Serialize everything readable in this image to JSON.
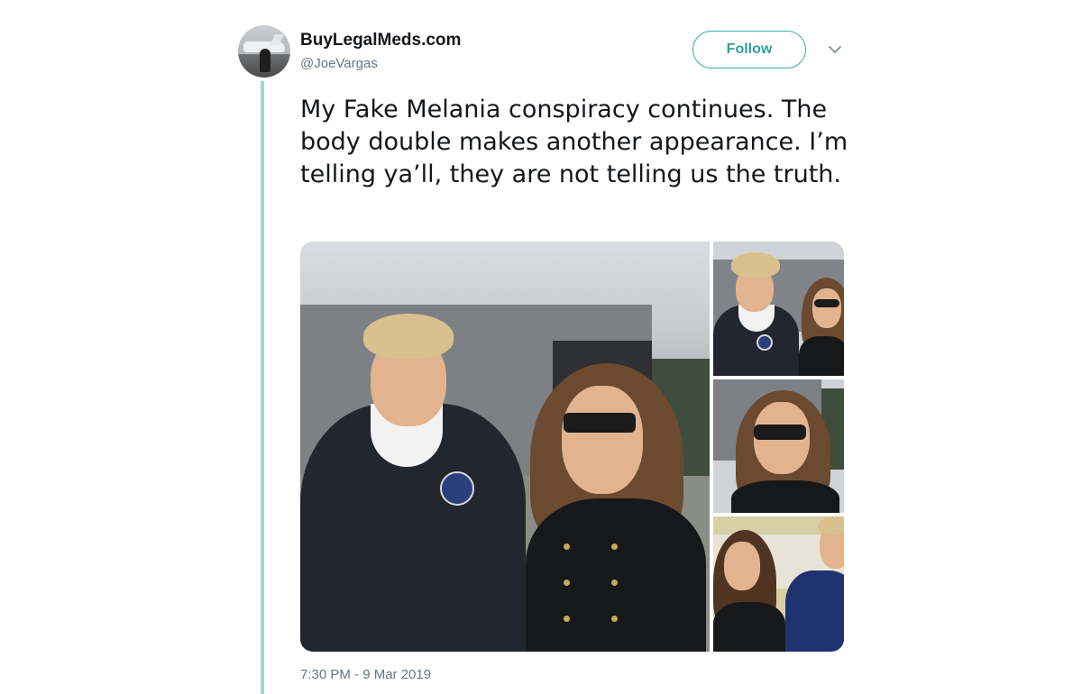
{
  "author": {
    "display_name": "BuyLegalMeds.com",
    "username": "@JoeVargas"
  },
  "actions": {
    "follow_label": "Follow",
    "more_icon": "chevron-down-icon"
  },
  "tweet": {
    "text": "My Fake Melania conspiracy continues. The body double makes another appearance. I’m telling ya’ll, they are not telling us the truth.",
    "timestamp": "7:30 PM - 9 Mar 2019",
    "media_count": 4
  },
  "colors": {
    "accent": "#3aa8a0",
    "thread_line": "#9fd8d2",
    "secondary_text": "#657786",
    "primary_text": "#14171a"
  }
}
